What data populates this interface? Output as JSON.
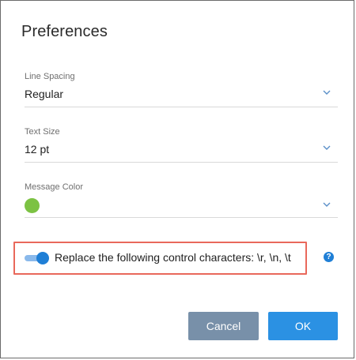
{
  "dialog": {
    "title": "Preferences"
  },
  "fields": {
    "line_spacing": {
      "label": "Line Spacing",
      "value": "Regular"
    },
    "text_size": {
      "label": "Text Size",
      "value": "12 pt"
    },
    "message_color": {
      "label": "Message Color",
      "color": "#7cc243"
    }
  },
  "control_chars": {
    "label": "Replace the following control characters: \\r, \\n, \\t",
    "enabled": true,
    "help_glyph": "?"
  },
  "buttons": {
    "cancel": "Cancel",
    "ok": "OK"
  },
  "colors": {
    "accent": "#1f7fd6",
    "cancel_bg": "#7890a9",
    "ok_bg": "#2b91e3",
    "highlight": "#e9685b"
  }
}
